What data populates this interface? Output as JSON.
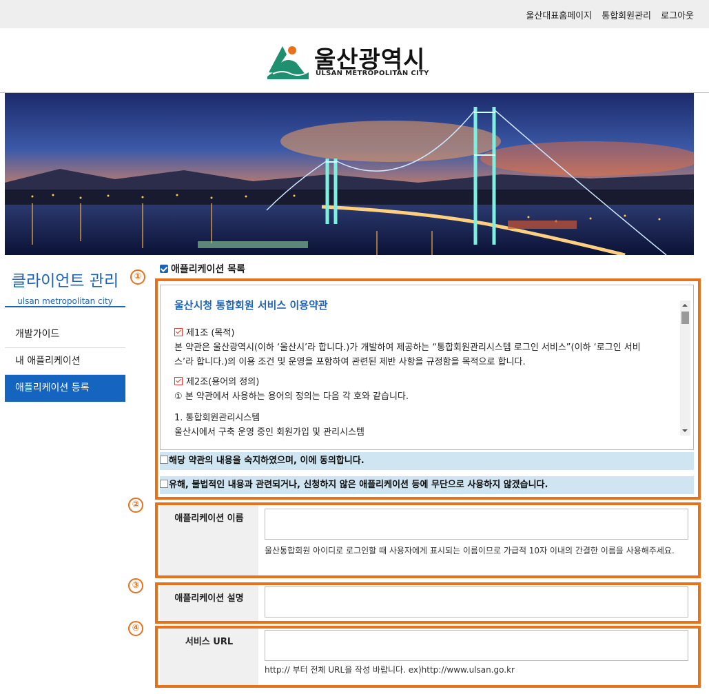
{
  "top_links": [
    "울산대표홈페이지",
    "통합회원관리",
    "로그아웃"
  ],
  "logo": {
    "name_ko": "울산광역시",
    "name_en": "ULSAN METROPOLITAN CITY"
  },
  "sidebar": {
    "title": "클라이언트 관리",
    "subtitle": "ulsan metropolitan city",
    "items": [
      {
        "label": "개발가이드",
        "active": false
      },
      {
        "label": "내 애플리케이션",
        "active": false
      },
      {
        "label": "애플리케이션 등록",
        "active": true
      }
    ]
  },
  "markers": [
    "①",
    "②",
    "③",
    "④"
  ],
  "section_title": "애플리케이션 목록",
  "terms": {
    "title": "울산시청 통합회원 서비스 이용약관",
    "art1_title": "제1조 (목적)",
    "art1_body": "본 약관은 울산광역시(이하 ‘울산시’라 합니다.)가 개발하여 제공하는 “통합회원관리시스템 로그인 서비스”(이하 ‘로그인 서비스’라 합니다.)의 이용 조건 및 운영을 포함하여 관련된 제반 사항을 규정함을 목적으로 합니다.",
    "art2_title": "제2조(용어의 정의)",
    "art2_body": "① 본 약관에서 사용하는 용어의 정의는 다음 각 호와 같습니다.",
    "item1_title": "1. 통합회원관리시스템",
    "item1_body": "울산시에서 구축 운영 중인 회원가입 및 관리시스템"
  },
  "agree1": "해당 약관의 내용을 숙지하였으며, 이에 동의합니다.",
  "agree2": "유해, 불법적인 내용과 관련되거나, 신청하지 않은 애플리케이션 등에 무단으로 사용하지 않겠습니다.",
  "form": {
    "app_name_label": "애플리케이션 이름",
    "app_name_value": "",
    "app_name_help": "울산통합회원 아이디로 로그인할 때 사용자에게 표시되는 이름이므로 가급적 10자 이내의 간결한 이름을 사용해주세요.",
    "app_desc_label": "애플리케이션 설명",
    "app_desc_value": "",
    "service_url_label": "서비스 URL",
    "service_url_value": "",
    "service_url_help": "http:// 부터 전체 URL을 작성 바랍니다. ex)http://www.ulsan.go.kr"
  },
  "colors": {
    "accent_blue": "#1f64b5",
    "highlight_orange": "#e8711c",
    "agree_bg": "#cfe6f2"
  }
}
